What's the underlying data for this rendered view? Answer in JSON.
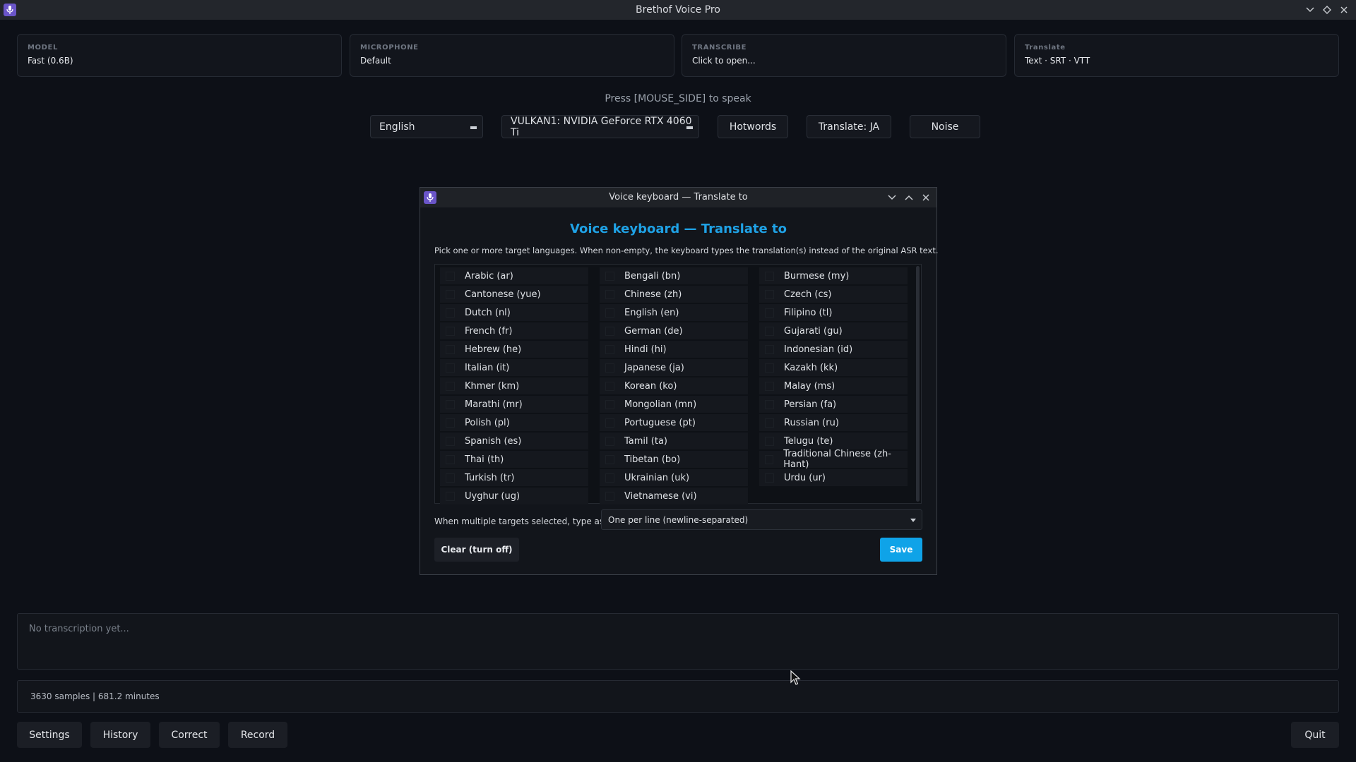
{
  "window": {
    "title": "Brethof Voice Pro",
    "controls": [
      "chevron-down-icon",
      "diamond-icon",
      "close-icon"
    ]
  },
  "cards": [
    {
      "label": "MODEL",
      "value": "Fast (0.6B)"
    },
    {
      "label": "MICROPHONE",
      "value": "Default"
    },
    {
      "label": "TRANSCRIBE",
      "value": "Click to open..."
    },
    {
      "label": "Translate",
      "value": "Text · SRT · VTT"
    }
  ],
  "hint": "Press [MOUSE_SIDE] to speak",
  "controls": {
    "language": "English",
    "device": "VULKAN1: NVIDIA GeForce RTX 4060 Ti",
    "hotwords": "Hotwords",
    "translate": "Translate: JA",
    "noise": "Noise"
  },
  "dialog": {
    "window_title": "Voice keyboard — Translate to",
    "heading": "Voice keyboard — Translate to",
    "description": "Pick one or more target languages. When non-empty, the keyboard types the translation(s) instead of the original ASR text.",
    "languages": [
      [
        "Arabic (ar)",
        "Bengali (bn)",
        "Burmese (my)"
      ],
      [
        "Cantonese (yue)",
        "Chinese (zh)",
        "Czech (cs)"
      ],
      [
        "Dutch (nl)",
        "English (en)",
        "Filipino (tl)"
      ],
      [
        "French (fr)",
        "German (de)",
        "Gujarati (gu)"
      ],
      [
        "Hebrew (he)",
        "Hindi (hi)",
        "Indonesian (id)"
      ],
      [
        "Italian (it)",
        "Japanese (ja)",
        "Kazakh (kk)"
      ],
      [
        "Khmer (km)",
        "Korean (ko)",
        "Malay (ms)"
      ],
      [
        "Marathi (mr)",
        "Mongolian (mn)",
        "Persian (fa)"
      ],
      [
        "Polish (pl)",
        "Portuguese (pt)",
        "Russian (ru)"
      ],
      [
        "Spanish (es)",
        "Tamil (ta)",
        "Telugu (te)"
      ],
      [
        "Thai (th)",
        "Tibetan (bo)",
        "Traditional Chinese (zh-Hant)"
      ],
      [
        "Turkish (tr)",
        "Ukrainian (uk)",
        "Urdu (ur)"
      ],
      [
        "Uyghur (ug)",
        "Vietnamese (vi)",
        null
      ]
    ],
    "multi_label": "When multiple targets selected, type as:",
    "multi_value": "One per line (newline-separated)",
    "clear_label": "Clear (turn off)",
    "save_label": "Save"
  },
  "output_placeholder": "No transcription yet...",
  "stats": "3630 samples | 681.2 minutes",
  "bottom": {
    "settings": "Settings",
    "history": "History",
    "correct": "Correct",
    "record": "Record",
    "quit": "Quit"
  },
  "colors": {
    "accent": "#1fa2e6",
    "save_button": "#0fa3e8",
    "app_icon": "#6a55c8"
  }
}
